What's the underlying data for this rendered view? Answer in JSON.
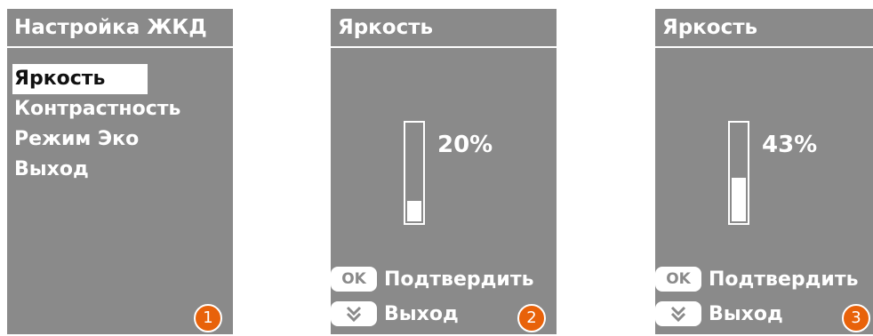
{
  "screens": [
    {
      "title": "Настройка ЖКД",
      "menu": [
        {
          "label": "Яркость",
          "selected": true
        },
        {
          "label": "Контрастность",
          "selected": false
        },
        {
          "label": "Режим Эко",
          "selected": false
        },
        {
          "label": "Выход",
          "selected": false
        }
      ],
      "badge": "1"
    },
    {
      "title": "Яркость",
      "brightness": {
        "value": 0.2,
        "label": "20%"
      },
      "ok_key": "OK",
      "confirm_label": "Подтвердить",
      "exit_label": "Выход",
      "badge": "2"
    },
    {
      "title": "Яркость",
      "brightness": {
        "value": 0.43,
        "label": "43%"
      },
      "ok_key": "OK",
      "confirm_label": "Подтвердить",
      "exit_label": "Выход",
      "badge": "3"
    }
  ],
  "colors": {
    "screen_bg": "#8a8a8a",
    "foreground": "#ffffff",
    "badge": "#e8620a"
  },
  "icons": {
    "ok_key": "ok-key-icon",
    "exit_key": "double-chevron-down-icon"
  }
}
